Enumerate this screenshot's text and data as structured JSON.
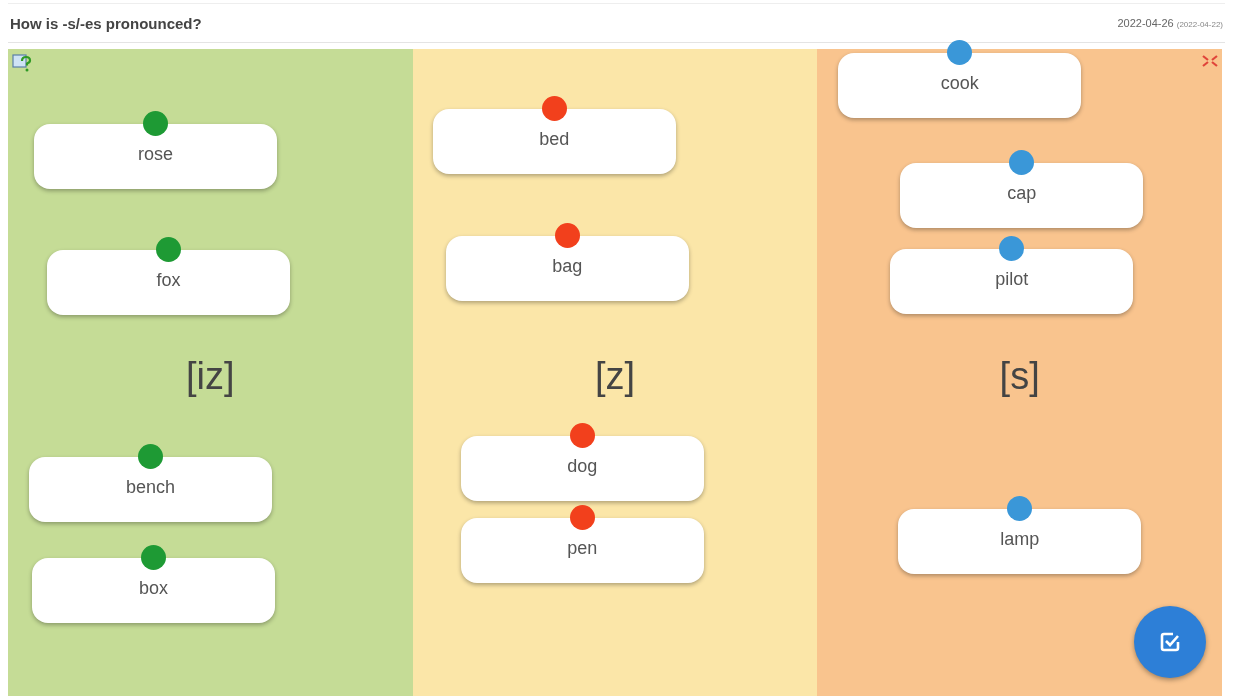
{
  "header": {
    "title": "How is -s/-es pronounced?",
    "date": "2022-04-26",
    "original_date": "(2022-04-22)"
  },
  "columns": [
    {
      "label": "[iz]",
      "cards": [
        {
          "word": "rose",
          "color": "#1e9a34"
        },
        {
          "word": "fox",
          "color": "#1e9a34"
        },
        {
          "word": "bench",
          "color": "#1e9a34"
        },
        {
          "word": "box",
          "color": "#1e9a34"
        }
      ]
    },
    {
      "label": "[z]",
      "cards": [
        {
          "word": "bed",
          "color": "#f2401c"
        },
        {
          "word": "bag",
          "color": "#f2401c"
        },
        {
          "word": "dog",
          "color": "#f2401c"
        },
        {
          "word": "pen",
          "color": "#f2401c"
        }
      ]
    },
    {
      "label": "[s]",
      "cards": [
        {
          "word": "cook",
          "color": "#3a97d8"
        },
        {
          "word": "cap",
          "color": "#3a97d8"
        },
        {
          "word": "pilot",
          "color": "#3a97d8"
        },
        {
          "word": "lamp",
          "color": "#3a97d8"
        }
      ]
    }
  ]
}
